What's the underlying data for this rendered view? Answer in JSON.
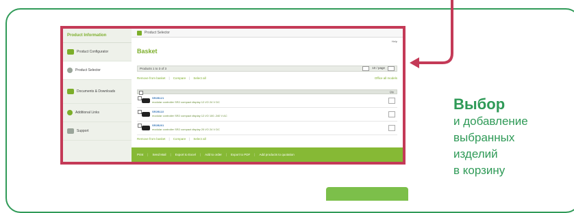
{
  "sidebar": {
    "title": "Product Information",
    "items": [
      {
        "label": "Product Configurator",
        "icon": "configurator-icon"
      },
      {
        "label": "Product Selector",
        "icon": "selector-icon"
      },
      {
        "label": "Documents & Downloads",
        "icon": "documents-icon"
      },
      {
        "label": "Additional Links",
        "icon": "links-icon"
      },
      {
        "label": "Support",
        "icon": "support-icon"
      }
    ]
  },
  "main": {
    "topbar_label": "Product Selector",
    "help": "Help",
    "title": "Basket",
    "toolbar_left": "Products 1 to 3 of 3",
    "toolbar_right": "10 / page",
    "actions_top": [
      "Remove from basket",
      "Compare",
      "Select all"
    ],
    "actions_top_right": "Office all models",
    "actions_bottom": [
      "Remove from basket",
      "Compare",
      "Select all"
    ],
    "qty_header": "Qty",
    "rows": [
      {
        "code": "SR2B121",
        "desc": "modular controller SR2 compact display 12 I/O 24 V DC"
      },
      {
        "code": "SR2B122",
        "desc": "modular controller SR2 compact display 12 I/O 100..240 V AC"
      },
      {
        "code": "SR2B201",
        "desc": "modular controller SR2 compact display 20 I/O 24 V DC"
      }
    ],
    "footer_links": [
      "Print",
      "Send Mail",
      "Export to Excel",
      "Add to order",
      "Export to PDF",
      "Add products to quotation"
    ]
  },
  "caption": {
    "title": "Выбор",
    "lines": [
      "и добавление",
      "выбранных",
      "изделий",
      "в корзину"
    ]
  },
  "colors": {
    "frame": "#2f9a57",
    "highlight": "#c43a57",
    "accent": "#7cae2a"
  }
}
